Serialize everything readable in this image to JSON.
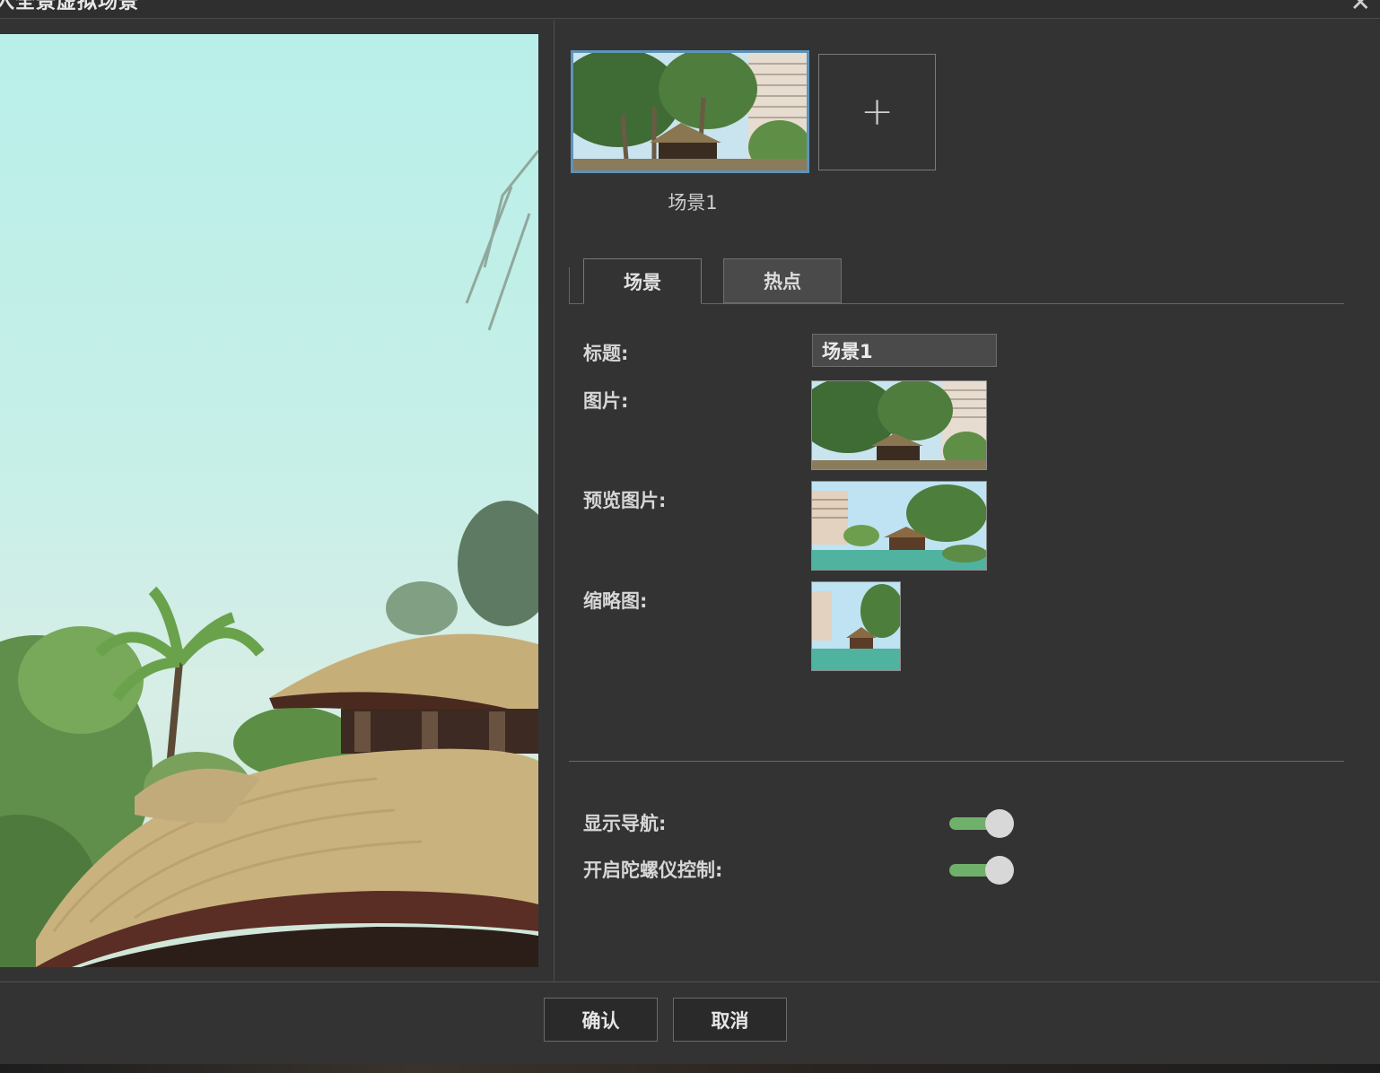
{
  "dialog": {
    "title": "入全景虚拟场景",
    "close_icon": "close-icon"
  },
  "scenes": {
    "items": [
      {
        "caption": "场景1"
      }
    ],
    "add_icon": "plus-icon"
  },
  "tabs": [
    {
      "label": "场景",
      "active": true
    },
    {
      "label": "热点",
      "active": false
    }
  ],
  "form": {
    "title_label": "标题:",
    "title_value": "场景1",
    "image_label": "图片:",
    "preview_image_label": "预览图片:",
    "thumbnail_label": "缩略图:"
  },
  "settings": {
    "show_nav_label": "显示导航:",
    "show_nav_on": true,
    "gyro_label": "开启陀螺仪控制:",
    "gyro_on": true
  },
  "buttons": {
    "confirm": "确认",
    "cancel": "取消"
  },
  "colors": {
    "background": "#333333",
    "accent_border": "#5f93b8",
    "toggle_on": "#6fb06a"
  }
}
